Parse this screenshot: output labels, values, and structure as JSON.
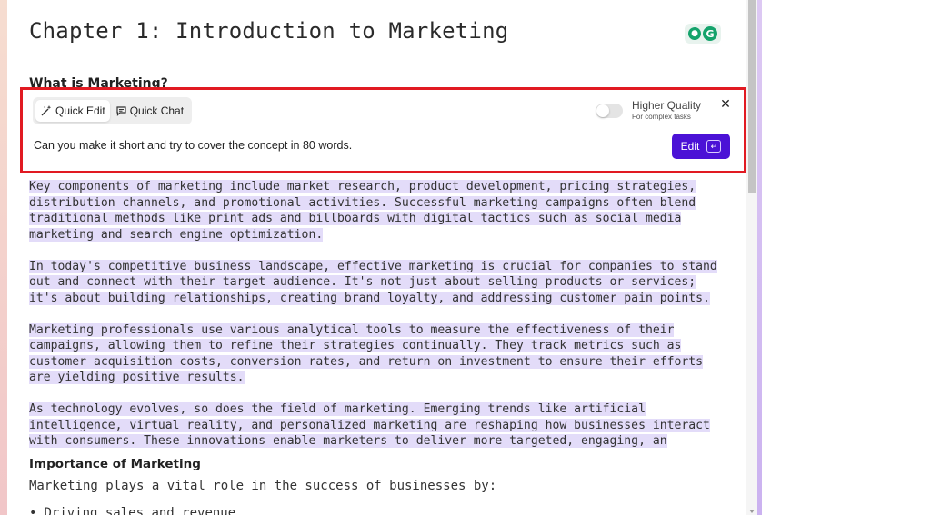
{
  "document": {
    "chapter_title": "Chapter 1: Introduction to Marketing",
    "subheading_partial": "What is Marketing?",
    "paragraphs": [
      "Key components of marketing include market research, product development, pricing strategies, distribution channels, and promotional activities. Successful marketing campaigns often blend traditional methods like print ads and billboards with digital tactics such as social media marketing and search engine optimization.",
      "In today's competitive business landscape, effective marketing is crucial for companies to stand out and connect with their target audience. It's not just about selling products or services; it's about building relationships, creating brand loyalty, and addressing customer pain points.",
      "Marketing professionals use various analytical tools to measure the effectiveness of their campaigns, allowing them to refine their strategies continually. They track metrics such as customer acquisition costs, conversion rates, and return on investment to ensure their efforts are yielding positive results.",
      "As technology evolves, so does the field of marketing. Emerging trends like artificial intelligence, virtual reality, and personalized marketing are reshaping how businesses interact with consumers. These innovations enable marketers to deliver more targeted, engaging, an"
    ],
    "importance_heading": "Importance of Marketing",
    "importance_intro": "Marketing plays a vital role in the success of businesses by:",
    "bullet_1": "Driving sales and revenue"
  },
  "edit_panel": {
    "tab_quick_edit": "Quick Edit",
    "tab_quick_chat": "Quick Chat",
    "quality_label": "Higher Quality",
    "quality_sub": "For complex tasks",
    "quality_enabled": false,
    "close_symbol": "✕",
    "prompt": "Can you make it short and try to cover the concept in 80 words.",
    "edit_button": "Edit",
    "enter_symbol": "↵",
    "accent_color": "#4b12d6",
    "highlight_color": "#e3dcf9",
    "frame_color": "#e11a22"
  },
  "icons": {
    "grammarly": "grammarly-icon",
    "quick_edit": "magic-wand-icon",
    "quick_chat": "chat-bubble-icon",
    "close": "close-icon",
    "enter": "enter-key-icon"
  }
}
